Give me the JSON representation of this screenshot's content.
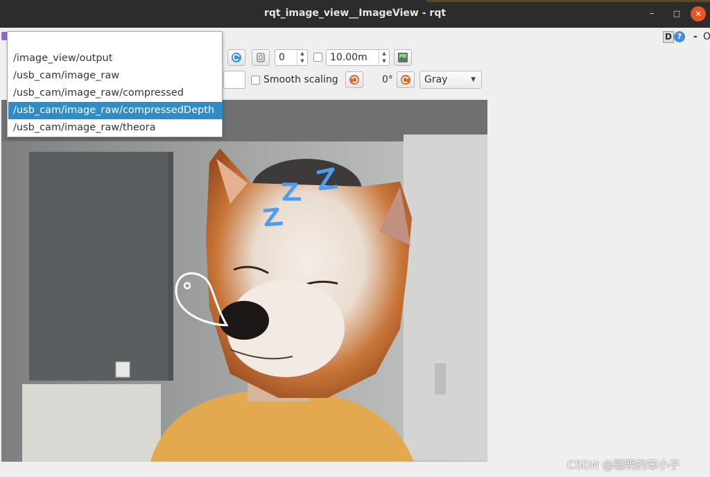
{
  "window": {
    "title": "rqt_image_view__ImageView - rqt",
    "minimize_glyph": "–",
    "maximize_glyph": "□",
    "close_glyph": "✕"
  },
  "plugin_header": {
    "help_badge": "D",
    "help_icon": "?",
    "dash_label": "-",
    "close_label": "O"
  },
  "topic_dropdown": {
    "items": [
      {
        "label": "/image_view/output",
        "selected": false
      },
      {
        "label": "/usb_cam/image_raw",
        "selected": false
      },
      {
        "label": "/usb_cam/image_raw/compressed",
        "selected": false
      },
      {
        "label": "/usb_cam/image_raw/compressedDepth",
        "selected": true
      },
      {
        "label": "/usb_cam/image_raw/theora",
        "selected": false
      }
    ]
  },
  "toolbar": {
    "refresh_icon": "refresh-icon",
    "zoom_fit_icon": "zoom-fit-icon",
    "spin_value": "0",
    "max_depth_value": "10.00m",
    "save_icon": "save-image-icon"
  },
  "toolbar2": {
    "smooth_scaling_label": "Smooth scaling",
    "rotation_label": "0°",
    "colormap_value": "Gray"
  },
  "accent_colors": {
    "selection": "#308cc6",
    "titlebar_close": "#e95420",
    "rotate_icon": "#e0662a"
  },
  "watermark": "CSDN @聪明的笨小子"
}
